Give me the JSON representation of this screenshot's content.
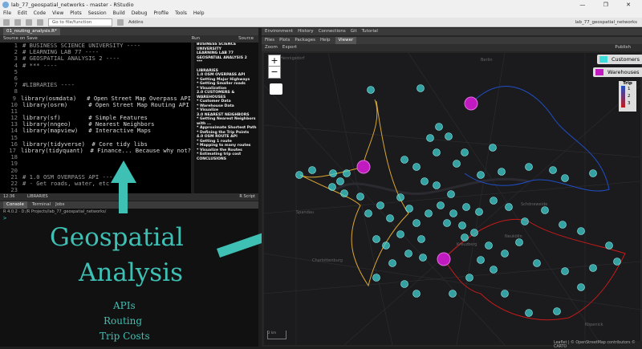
{
  "window": {
    "title": "lab_77_geospatial_networks - master - RStudio",
    "controls": "— ❐ ✕"
  },
  "menu": [
    "File",
    "Edit",
    "Code",
    "View",
    "Plots",
    "Session",
    "Build",
    "Debug",
    "Profile",
    "Tools",
    "Help"
  ],
  "toolbar": {
    "goto_placeholder": "Go to file/function",
    "addins": "Addins",
    "project": "lab_77_geospatial_networks"
  },
  "editor": {
    "tab": "01_routing_analysis.R*",
    "source_on_save": "Source on Save",
    "run": "Run",
    "source": "Source",
    "status_left": "12:36",
    "status_section": "LIBRARIES",
    "status_right": "R Script"
  },
  "code_lines": [
    {
      "n": "1",
      "t": "# BUSINESS SCIENCE UNIVERSITY ----",
      "c": true
    },
    {
      "n": "2",
      "t": "# LEARNING LAB 77 ----",
      "c": true
    },
    {
      "n": "3",
      "t": "# GEOSPATIAL ANALYSIS 2 ----",
      "c": true
    },
    {
      "n": "4",
      "t": "# *** ----",
      "c": true
    },
    {
      "n": "5",
      "t": "",
      "c": false
    },
    {
      "n": "6",
      "t": "",
      "c": false
    },
    {
      "n": "7",
      "t": "#LIBRARIES ----",
      "c": true
    },
    {
      "n": "8",
      "t": "",
      "c": false
    },
    {
      "n": "9",
      "t": "library(osmdata)   # Open Street Map Overpass API",
      "c": false
    },
    {
      "n": "10",
      "t": "library(osrm)      # Open Street Map Routing API",
      "c": false
    },
    {
      "n": "11",
      "t": "",
      "c": false
    },
    {
      "n": "12",
      "t": "library(sf)        # Simple Features",
      "c": false
    },
    {
      "n": "13",
      "t": "library(nngeo)     # Nearest Neighbors",
      "c": false
    },
    {
      "n": "14",
      "t": "library(mapview)   # Interactive Maps",
      "c": false
    },
    {
      "n": "15",
      "t": "",
      "c": false
    },
    {
      "n": "16",
      "t": "library(tidyverse)  # Core tidy libs",
      "c": false
    },
    {
      "n": "17",
      "t": "library(tidyquant)  # Finance... Because why not?",
      "c": false
    },
    {
      "n": "18",
      "t": "",
      "c": false
    },
    {
      "n": "19",
      "t": "",
      "c": false
    },
    {
      "n": "20",
      "t": "",
      "c": false
    },
    {
      "n": "21",
      "t": "# 1.0 OSM OVERPASS API ----",
      "c": true
    },
    {
      "n": "22",
      "t": "# - Get roads, water, etc",
      "c": true
    },
    {
      "n": "23",
      "t": "",
      "c": false
    }
  ],
  "outline": [
    "BUSINESS SCIENCE UNIVERSITY",
    "LEARNING LAB 77",
    "GEOSPATIAL ANALYSIS 2",
    "***",
    "LIBRARIES",
    "1.0 OSM OVERPASS API",
    "* Getting Major Highways",
    "* Getting Smaller roads",
    "* Visualization",
    "2.0 CUSTOMERS & WAREHOUSES",
    "* Customer Data",
    "* Warehouse Data",
    "* Visualize",
    "3.0 NEAREST NEIGHBORS",
    "* Getting Nearest Neighbors with ...",
    "* Approximate Shortest Path",
    "* Defining the Trip Points",
    "4.0 OSM ROUTE API",
    "* Getting 1 route",
    "* Mapping to many routes",
    "* Visualize the Routes",
    "* Estimating trip cost",
    "CONCLUSIONS"
  ],
  "console": {
    "tabs": [
      "Console",
      "Terminal",
      "Jobs"
    ],
    "path": "R 4.0.2 · D:/R Projects/lab_77_geospatial_networks/",
    "prompt": ">"
  },
  "overlay": {
    "title_line1": "Geospatial",
    "title_line2": "Analysis",
    "items": [
      "APIs",
      "Routing",
      "Trip Costs"
    ]
  },
  "viewer": {
    "top_tabs": [
      "Environment",
      "History",
      "Connections",
      "Git",
      "Tutorial"
    ],
    "sub_tabs": [
      "Files",
      "Plots",
      "Packages",
      "Help",
      "Viewer"
    ],
    "zoom_label": "Zoom",
    "export_label": "Export",
    "publish_label": "Publish"
  },
  "map": {
    "zoom_in": "+",
    "zoom_out": "−",
    "legend_customers": "Customers",
    "legend_warehouses": "Warehouses",
    "trip_legend_title": "Trip",
    "trip_legend_items": [
      "1",
      "2",
      "3"
    ],
    "attribution": "Leaflet | © OpenStreetMap contributors © CARTO",
    "scale_text": "2 km",
    "place_labels": [
      "Hennigsdorf",
      "Berlin",
      "Spandau",
      "Charlottenburg",
      "Kreuzberg",
      "Köpenick",
      "Neukölln",
      "Schöneweide"
    ],
    "colors": {
      "customer": "#3fdcdc",
      "warehouse": "#c01ac0",
      "trip1": "#1f4fc6",
      "trip2": "#d9a534",
      "trip3": "#c51a1a",
      "accent": "#3fc0b4"
    }
  }
}
